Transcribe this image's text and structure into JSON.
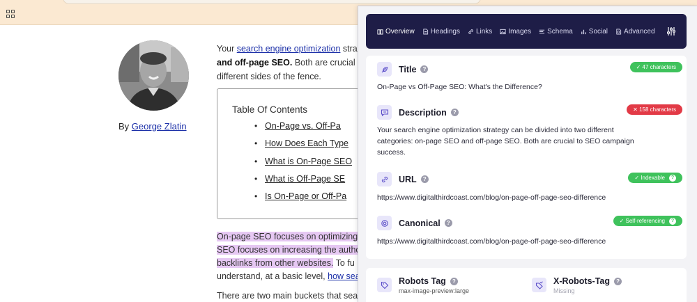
{
  "browser": {
    "apps_icon": "apps-grid-icon"
  },
  "article": {
    "author_prefix": "By",
    "author_name": "George Zlatin",
    "intro": {
      "line1_pre": "Your ",
      "line1_link": "search engine optimization",
      "line1_post": " stra",
      "line2_bold": "and off-page SEO.",
      "line2_post": " Both are crucial",
      "line3": "different sides of the fence."
    },
    "toc": {
      "title": "Table Of Contents",
      "items": [
        "On-Page vs. Off-Pa",
        "How Does Each Type",
        "What is On-Page SEO",
        "What is Off-Page SE",
        "Is On-Page or Off-Pa"
      ]
    },
    "para": {
      "line1": "On-page SEO focuses on optimizing",
      "line2": "SEO focuses on increasing the autho",
      "line3_hl": "backlinks from other websites.",
      "line3_post": " To fu",
      "line4_pre": "understand, at a basic level, ",
      "line4_link": "how sea"
    },
    "para2": "There are two main buckets that sea"
  },
  "panel": {
    "tabs": [
      {
        "label": "Overview",
        "icon": "book-icon",
        "active": true
      },
      {
        "label": "Headings",
        "icon": "document-icon"
      },
      {
        "label": "Links",
        "icon": "link-icon"
      },
      {
        "label": "Images",
        "icon": "image-icon"
      },
      {
        "label": "Schema",
        "icon": "list-icon"
      },
      {
        "label": "Social",
        "icon": "bar-chart-icon"
      },
      {
        "label": "Advanced",
        "icon": "document-search-icon"
      }
    ],
    "settings_icon": "sliders-icon",
    "title": {
      "label": "Title",
      "badge": "✓ 47 characters",
      "value": "On-Page vs Off-Page SEO: What's the Difference?"
    },
    "description": {
      "label": "Description",
      "badge": "✕ 158 characters",
      "lines": [
        "Your search engine optimization strategy can be divided into two different",
        "categories: on-page SEO and off-page SEO. Both are crucial to SEO campaign",
        "success."
      ]
    },
    "url": {
      "label": "URL",
      "badge": "✓ Indexable",
      "value": "https://www.digitalthirdcoast.com/blog/on-page-off-page-seo-difference"
    },
    "canonical": {
      "label": "Canonical",
      "badge": "✓ Self-referencing",
      "value": "https://www.digitalthirdcoast.com/blog/on-page-off-page-seo-difference"
    },
    "robots": {
      "label": "Robots Tag",
      "value": "max-image-preview:large"
    },
    "xrobots": {
      "label": "X-Robots-Tag",
      "value": "Missing"
    },
    "help_glyph": "?",
    "colors": {
      "nav_bg": "#1e1d47",
      "accent": "#5b4ec9",
      "green": "#3fc25c",
      "red": "#e23a46"
    }
  }
}
